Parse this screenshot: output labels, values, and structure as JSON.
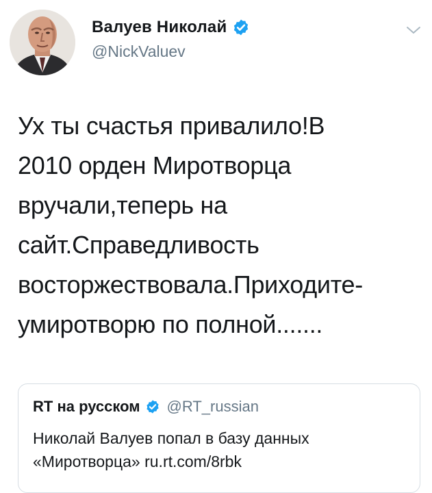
{
  "tweet": {
    "author": {
      "name": "Валуев Николай",
      "handle": "@NickValuev",
      "verified_icon": "verified-badge-icon"
    },
    "menu_icon": "chevron-down-icon",
    "text_lines": [
      "Ух ты счастья привалило!В",
      "2010 орден Миротворца",
      "вручали,теперь на",
      "сайт.Справедливость",
      "восторжествовала.Приходите-",
      "умиротворю по полной......."
    ]
  },
  "quoted_tweet": {
    "author": {
      "name": "RT на русском",
      "handle": "@RT_russian",
      "verified_icon": "verified-badge-icon"
    },
    "text_lines": [
      "Николай Валуев попал в базу данных",
      "«Миротворца» ru.rt.com/8rbk"
    ]
  },
  "colors": {
    "text": "#14171a",
    "secondary": "#657786",
    "verified": "#1da1f2",
    "border": "#d6dde3"
  }
}
